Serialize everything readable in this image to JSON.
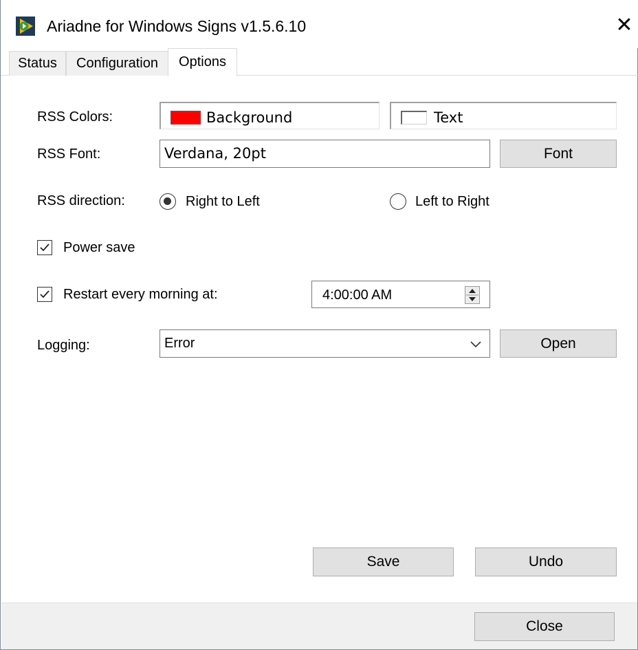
{
  "window": {
    "title": "Ariadne for Windows Signs v1.5.6.10",
    "icon": "ariadne-app-icon",
    "close_glyph": "✕"
  },
  "tabs": [
    {
      "label": "Status",
      "active": false
    },
    {
      "label": "Configuration",
      "active": false
    },
    {
      "label": "Options",
      "active": true
    }
  ],
  "options": {
    "rss_colors": {
      "label": "RSS Colors:",
      "background_label": "Background",
      "background_color": "#ff0000",
      "text_label": "Text",
      "text_color": "#ffffff"
    },
    "rss_font": {
      "label": "RSS Font:",
      "value": "Verdana, 20pt",
      "button_label": "Font"
    },
    "rss_direction": {
      "label": "RSS direction:",
      "right_to_left_label": "Right to Left",
      "left_to_right_label": "Left to Right",
      "selected": "Right to Left"
    },
    "power_save": {
      "label": "Power save",
      "checked": true
    },
    "restart": {
      "label": "Restart every morning at:",
      "checked": true,
      "time": "4:00:00 AM"
    },
    "logging": {
      "label": "Logging:",
      "value": "Error",
      "open_label": "Open"
    },
    "save_label": "Save",
    "undo_label": "Undo"
  },
  "footer": {
    "close_label": "Close"
  },
  "colors": {
    "accent_red": "#ff0000",
    "button_face": "#e1e1e1",
    "footer_bg": "#f0f0f0"
  }
}
